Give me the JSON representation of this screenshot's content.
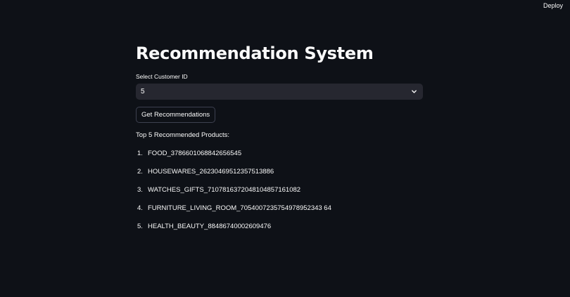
{
  "header": {
    "deploy_label": "Deploy"
  },
  "main": {
    "title": "Recommendation System",
    "select": {
      "label": "Select Customer ID",
      "value": "5"
    },
    "button_label": "Get Recommendations",
    "results_heading": "Top 5 Recommended Products:",
    "results": [
      {
        "num": "1.",
        "text": "FOOD_3786601068842656545"
      },
      {
        "num": "2.",
        "text": "HOUSEWARES_26230469512357513886"
      },
      {
        "num": "3.",
        "text": "WATCHES_GIFTS_7107816372048104857161082"
      },
      {
        "num": "4.",
        "text": "FURNITURE_LIVING_ROOM_7054007235754978952343 64"
      },
      {
        "num": "5.",
        "text": "HEALTH_BEAUTY_88486740002609476"
      }
    ]
  }
}
